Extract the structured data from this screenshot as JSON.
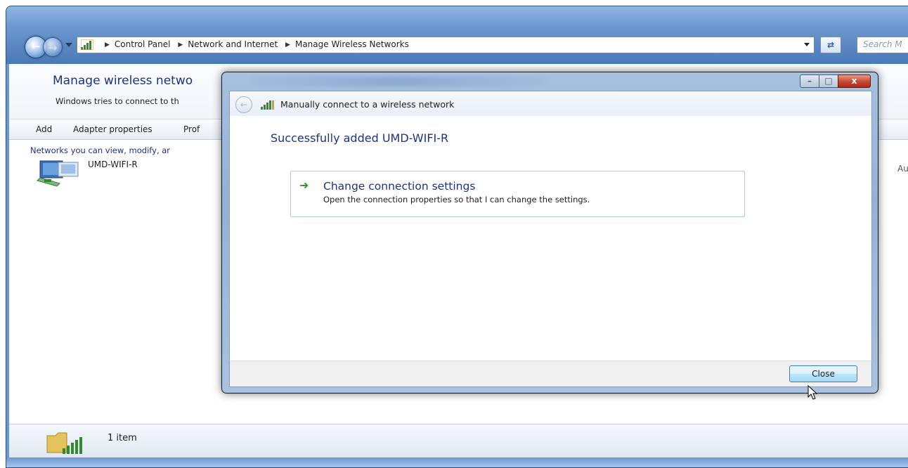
{
  "explorer": {
    "breadcrumb": [
      "Control Panel",
      "Network and Internet",
      "Manage Wireless Networks"
    ],
    "search_placeholder": "Search M",
    "title": "Manage wireless netwo",
    "subtitle": "Windows tries to connect to th",
    "toolbar": {
      "add": "Add",
      "adapter": "Adapter properties",
      "profile": "Prof"
    },
    "group_header": "Networks you can view, modify, ar",
    "network": {
      "name": "UMD-WIFI-R",
      "mode": "Au"
    },
    "status": {
      "count": "1 item"
    }
  },
  "dialog": {
    "header_title": "Manually connect to a wireless network",
    "success_message": "Successfully added UMD-WIFI-R",
    "command": {
      "title": "Change connection settings",
      "description": "Open the connection properties so that I can change the settings."
    },
    "close_label": "Close",
    "caption": {
      "minimize": "–",
      "maximize": "□",
      "close": "x"
    }
  },
  "colors": {
    "link_blue": "#1e3287",
    "command_arrow": "#2e9d2e",
    "glass": "#6d98cf",
    "close_red": "#c7452e"
  },
  "icons": {
    "back": "back-arrow-icon",
    "forward": "forward-arrow-icon",
    "signal": "wireless-signal-icon",
    "network": "wireless-network-icon",
    "refresh": "refresh-icon"
  }
}
